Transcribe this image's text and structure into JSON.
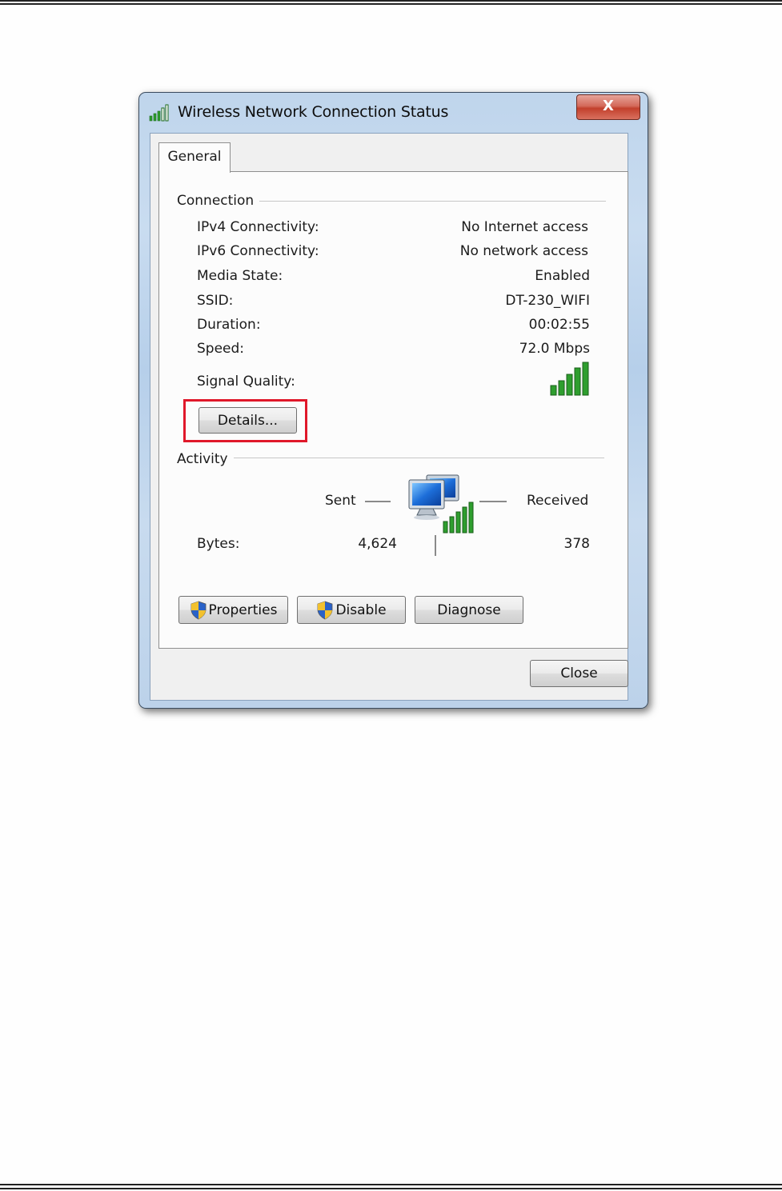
{
  "window": {
    "title": "Wireless Network Connection Status",
    "close_glyph": "X",
    "title_icon": "wifi-signal-icon"
  },
  "tabs": [
    {
      "label": "General",
      "selected": true
    }
  ],
  "connection": {
    "group_label": "Connection",
    "rows": [
      {
        "label": "IPv4 Connectivity:",
        "value": "No Internet access"
      },
      {
        "label": "IPv6 Connectivity:",
        "value": "No network access"
      },
      {
        "label": "Media State:",
        "value": "Enabled"
      },
      {
        "label": "SSID:",
        "value": "DT-230_WIFI"
      },
      {
        "label": "Duration:",
        "value": "00:02:55"
      },
      {
        "label": "Speed:",
        "value": "72.0 Mbps"
      }
    ],
    "signal_quality_label": "Signal Quality:",
    "signal_bars": 5,
    "details_button": "Details..."
  },
  "activity": {
    "group_label": "Activity",
    "sent_label": "Sent",
    "received_label": "Received",
    "bytes_label": "Bytes:",
    "bytes_sent": "4,624",
    "bytes_received": "378",
    "icon": "network-computers-icon"
  },
  "buttons": {
    "properties": "Properties",
    "disable": "Disable",
    "diagnose": "Diagnose",
    "close": "Close"
  },
  "colors": {
    "highlight": "#e0182a",
    "signal_green": "#2e9e2e",
    "title_close_red": "#c2402c"
  }
}
